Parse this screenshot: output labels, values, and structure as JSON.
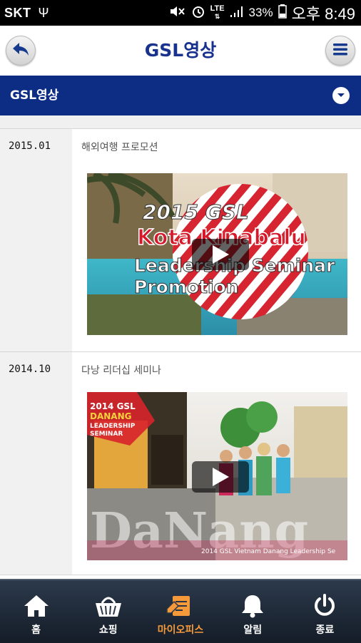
{
  "status_bar": {
    "carrier": "SKT",
    "network": "LTE",
    "battery": "33%",
    "time": "오후 8:49"
  },
  "app_bar": {
    "title": "GSL영상",
    "back_icon": "back-arrow-icon",
    "menu_icon": "hamburger-menu-icon"
  },
  "category_bar": {
    "title": "GSL영상",
    "toggle_icon": "chevron-down-icon"
  },
  "videos": [
    {
      "date": "2015.01",
      "title": "해외여행 프로모션",
      "thumb_text": [
        "2015 GSL",
        "Kota Kinabalu",
        "Leadership Seminar",
        "Promotion"
      ]
    },
    {
      "date": "2014.10",
      "title": "다낭 리더십 세미나",
      "thumb_text": [
        "2014 GSL",
        "DANANG",
        "LEADERSHIP",
        "SEMINAR",
        "DaNang",
        "2014 GSL Vietnam Danang Leadership Se"
      ]
    }
  ],
  "bottom_nav": {
    "items": [
      {
        "label": "홈",
        "icon": "home-icon"
      },
      {
        "label": "쇼핑",
        "icon": "shopping-basket-icon"
      },
      {
        "label": "마이오피스",
        "icon": "my-office-icon"
      },
      {
        "label": "알림",
        "icon": "bell-icon"
      },
      {
        "label": "종료",
        "icon": "power-icon"
      }
    ],
    "active_index": 2,
    "active_color": "#f59a3b"
  },
  "colors": {
    "brand_blue": "#18328e",
    "category_bar": "#0d2c84",
    "nav_background": "#1c2532"
  }
}
